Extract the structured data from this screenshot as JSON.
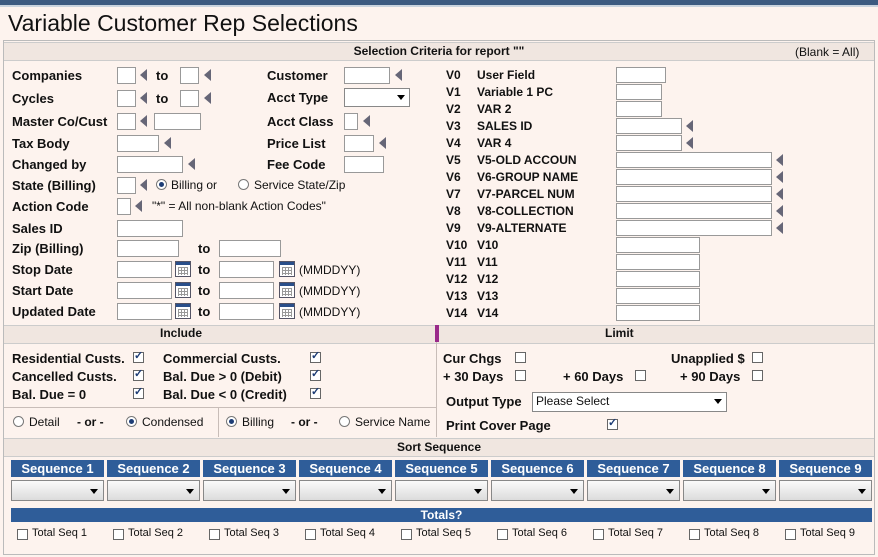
{
  "title": "Variable Customer Rep Selections",
  "criteria": {
    "header": "Selection Criteria for report \"\"",
    "blank_note": "(Blank = All)"
  },
  "left": {
    "companies": "Companies",
    "to": "to",
    "cycles": "Cycles",
    "master": "Master Co/Cust",
    "tax_body": "Tax Body",
    "changed_by": "Changed by",
    "state_billing": "State (Billing)",
    "billing_or": "Billing or",
    "service_state_zip": "Service State/Zip",
    "action_code": "Action Code",
    "action_note": "\"*\" = All non-blank Action Codes\"",
    "sales_id": "Sales ID",
    "zip_billing": "Zip (Billing)",
    "stop_date": "Stop Date",
    "start_date": "Start Date",
    "updated_date": "Updated Date",
    "mmddyy": "(MMDDYY)"
  },
  "middle": {
    "customer": "Customer",
    "acct_type": "Acct Type",
    "acct_class": "Acct Class",
    "price_list": "Price List",
    "fee_code": "Fee Code"
  },
  "vfields": [
    {
      "code": "V0",
      "name": "User Field"
    },
    {
      "code": "V1",
      "name": "Variable 1 PC"
    },
    {
      "code": "V2",
      "name": "VAR 2"
    },
    {
      "code": "V3",
      "name": "SALES ID"
    },
    {
      "code": "V4",
      "name": "VAR 4"
    },
    {
      "code": "V5",
      "name": "V5-OLD ACCOUN"
    },
    {
      "code": "V6",
      "name": "V6-GROUP NAME"
    },
    {
      "code": "V7",
      "name": "V7-PARCEL NUM"
    },
    {
      "code": "V8",
      "name": "V8-COLLECTION"
    },
    {
      "code": "V9",
      "name": "V9-ALTERNATE"
    },
    {
      "code": "V10",
      "name": "V10"
    },
    {
      "code": "V11",
      "name": "V11"
    },
    {
      "code": "V12",
      "name": "V12"
    },
    {
      "code": "V13",
      "name": "V13"
    },
    {
      "code": "V14",
      "name": "V14"
    }
  ],
  "include": {
    "header": "Include",
    "residential": "Residential Custs.",
    "commercial": "Commercial Custs.",
    "cancelled": "Cancelled Custs.",
    "bal_debit": "Bal. Due > 0 (Debit)",
    "bal_zero": "Bal. Due = 0",
    "bal_credit": "Bal. Due < 0 (Credit)",
    "detail": "Detail",
    "or": "- or -",
    "condensed": "Condensed",
    "billing": "Billing",
    "service_name": "Service Name"
  },
  "limit": {
    "header": "Limit",
    "cur_chgs": "Cur Chgs",
    "unapplied": "Unapplied $",
    "d30": "+ 30 Days",
    "d60": "+ 60 Days",
    "d90": "+ 90 Days",
    "output_type": "Output Type",
    "output_value": "Please Select",
    "print_cover": "Print Cover Page"
  },
  "sort": {
    "header": "Sort Sequence",
    "sequences": [
      "Sequence 1",
      "Sequence 2",
      "Sequence 3",
      "Sequence 4",
      "Sequence 5",
      "Sequence 6",
      "Sequence 7",
      "Sequence 8",
      "Sequence 9"
    ],
    "totals_header": "Totals?",
    "totals": [
      "Total Seq 1",
      "Total Seq 2",
      "Total Seq 3",
      "Total Seq 4",
      "Total Seq 5",
      "Total Seq 6",
      "Total Seq 7",
      "Total Seq 8",
      "Total Seq 9"
    ]
  }
}
